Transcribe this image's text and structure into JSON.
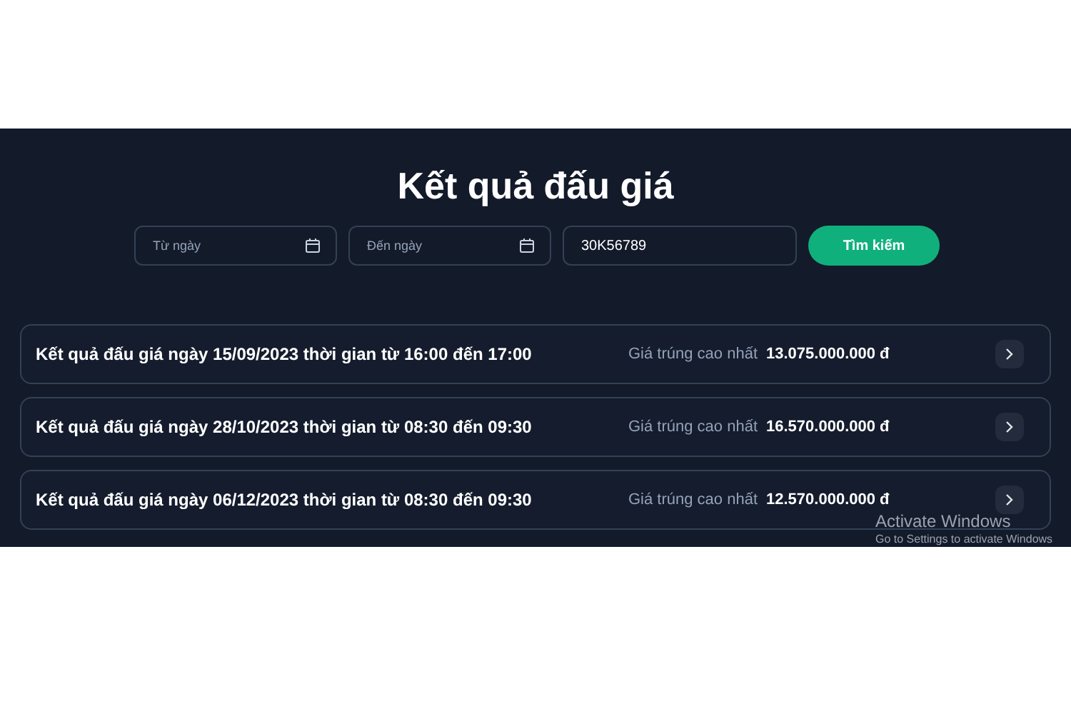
{
  "title": "Kết quả đấu giá",
  "filters": [
    {
      "kind": "date",
      "placeholder": "Từ ngày"
    },
    {
      "kind": "date",
      "placeholder": "Đến ngày"
    },
    {
      "kind": "text",
      "value": "30K56789"
    }
  ],
  "search_button": "Tìm kiếm",
  "results": [
    {
      "title": "Kết quả đấu giá ngày 15/09/2023 thời gian từ 16:00 đến 17:00",
      "price_label": "Giá trúng cao nhất",
      "price": "13.075.000.000 đ"
    },
    {
      "title": "Kết quả đấu giá ngày 28/10/2023 thời gian từ 08:30 đến 09:30",
      "price_label": "Giá trúng cao nhất",
      "price": "16.570.000.000 đ"
    },
    {
      "title": "Kết quả đấu giá ngày 06/12/2023 thời gian từ 08:30 đến 09:30",
      "price_label": "Giá trúng cao nhất",
      "price": "12.570.000.000 đ"
    }
  ],
  "activation_notice": {
    "title": "Activate Windows",
    "subtitle": "Go to Settings to activate Windows"
  }
}
